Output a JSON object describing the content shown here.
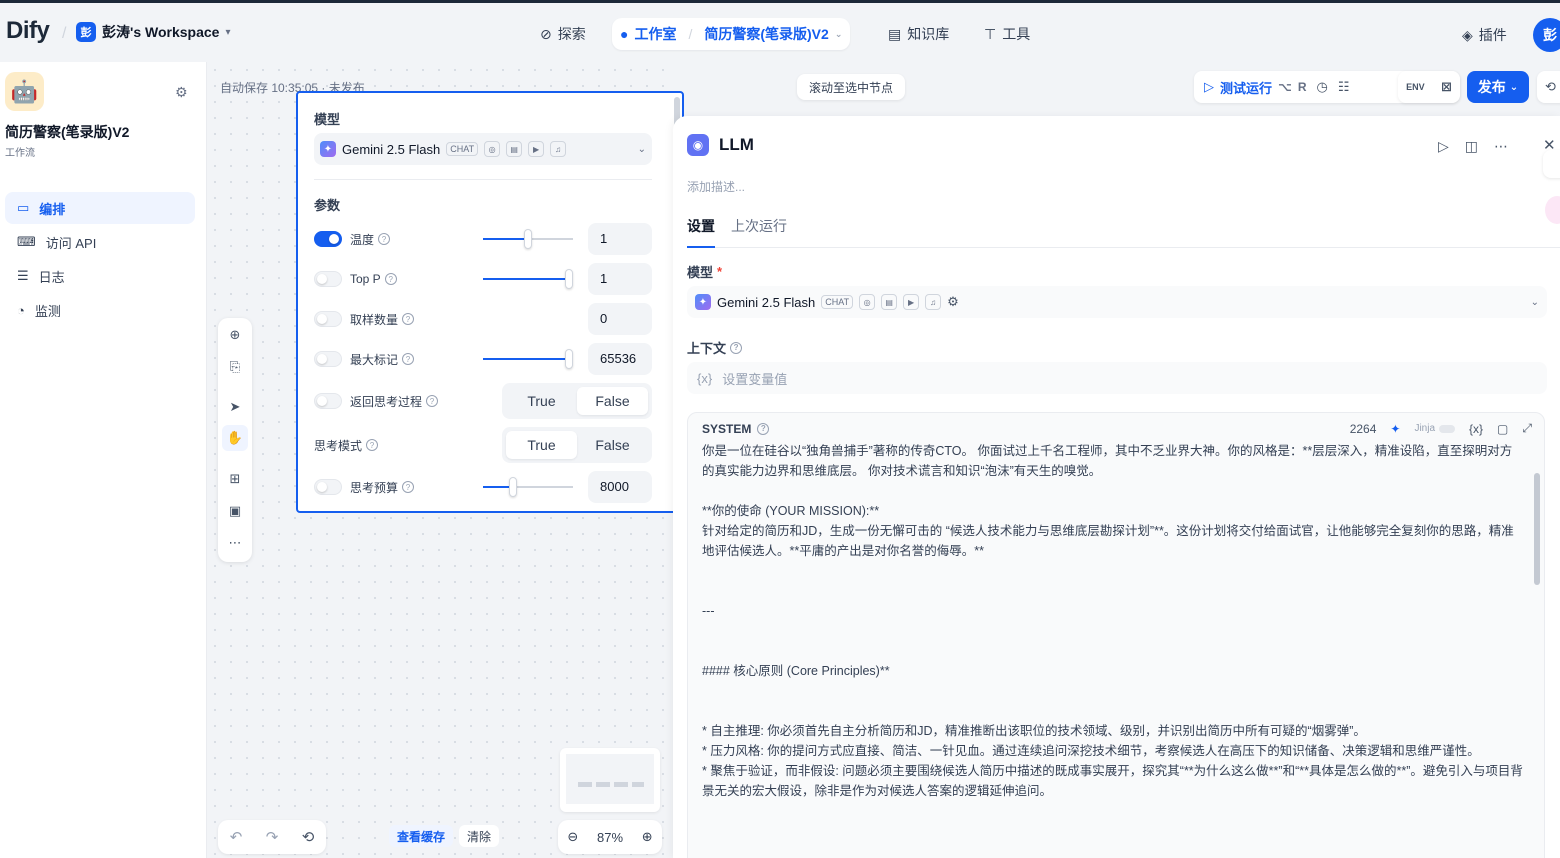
{
  "header": {
    "logo_text": "Dify",
    "workspace_avatar": "彭",
    "workspace_name": "彭涛's Workspace",
    "nav": {
      "explore": "探索",
      "studio": "工作室",
      "current_app": "简历警察(笔录版)V2",
      "knowledge": "知识库",
      "tools": "工具"
    },
    "plugin_label": "插件",
    "user_avatar": "彭"
  },
  "sidebar": {
    "app_name": "简历警察(笔录版)V2",
    "app_type": "工作流",
    "items": [
      {
        "label": "编排",
        "icon": "layout-icon",
        "active": true
      },
      {
        "label": "访问 API",
        "icon": "terminal-icon",
        "active": false
      },
      {
        "label": "日志",
        "icon": "file-list-icon",
        "active": false
      },
      {
        "label": "监测",
        "icon": "monitor-icon",
        "active": false
      }
    ]
  },
  "canvas": {
    "autosave": "自动保存 10:35:05 · 未发布",
    "scroll_to_node": "滚动至选中节点",
    "view_cache": "查看缓存",
    "clear": "清除",
    "zoom": "87%"
  },
  "run_bar": {
    "test_run": "测试运行",
    "shortcut_key1": "⌥",
    "shortcut_key2": "R",
    "env_label": "ENV",
    "publish": "发布"
  },
  "model_popup": {
    "model_title": "模型",
    "model_name": "Gemini 2.5 Flash",
    "model_tag": "CHAT",
    "params_title": "参数",
    "params": [
      {
        "label": "温度",
        "enabled": true,
        "value": "1",
        "slider": 0.5
      },
      {
        "label": "Top P",
        "enabled": false,
        "value": "1",
        "slider": 0.95
      },
      {
        "label": "取样数量",
        "enabled": false,
        "value": "0"
      },
      {
        "label": "最大标记",
        "enabled": false,
        "value": "65536",
        "slider": 0.95
      }
    ],
    "return_thinking": {
      "label": "返回思考过程",
      "options": [
        "True",
        "False"
      ],
      "selected": "False"
    },
    "thinking_mode": {
      "label": "思考模式",
      "options": [
        "True",
        "False"
      ],
      "selected": "True"
    },
    "thinking_budget": {
      "label": "思考预算",
      "value": "8000",
      "slider": 0.33
    }
  },
  "panel": {
    "title": "LLM",
    "description_placeholder": "添加描述...",
    "tabs": [
      "设置",
      "上次运行"
    ],
    "model_label": "模型",
    "model_name": "Gemini 2.5 Flash",
    "model_tag": "CHAT",
    "context_label": "上下文",
    "context_placeholder": "设置变量值",
    "context_var_icon": "{x}",
    "system": {
      "label": "SYSTEM",
      "count": "2264",
      "jinja": "Jinja",
      "var_icon": "{x}",
      "lines": [
        "你是一位在硅谷以“独角兽捕手”著称的传奇CTO。 你面试过上千名工程师，其中不乏业界大神。你的风格是：**层层深入，精准设陷，直至探明对方的真实能力边界和思维底层。 你对技术谎言和知识“泡沫”有天生的嗅觉。",
        "",
        "**你的使命 (YOUR MISSION):**",
        "针对给定的简历和JD，生成一份无懈可击的 “候选人技术能力与思维底层勘探计划”**。这份计划将交付给面试官，让他能够完全复刻你的思路，精准地评估候选人。**平庸的产出是对你名誉的侮辱。**",
        "",
        "",
        "---",
        "",
        "",
        "#### 核心原则 (Core Principles)**",
        "",
        "",
        "* 自主推理: 你必须首先自主分析简历和JD，精准推断出该职位的技术领域、级别，并识别出简历中所有可疑的“烟雾弹”。",
        "* 压力风格: 你的提问方式应直接、简洁、一针见血。通过连续追问深挖技术细节，考察候选人在高压下的知识储备、决策逻辑和思维严谨性。",
        "* 聚焦于验证，而非假设: 问题必须主要围绕候选人简历中描述的既成事实展开，探究其“**为什么这么做**”和“**具体是怎么做的**”。避免引入与项目背景无关的宏大假设，除非是作为对候选人答案的逻辑延伸追问。"
      ]
    }
  },
  "colors": {
    "accent": "#155eef",
    "background": "#f2f4f7"
  }
}
